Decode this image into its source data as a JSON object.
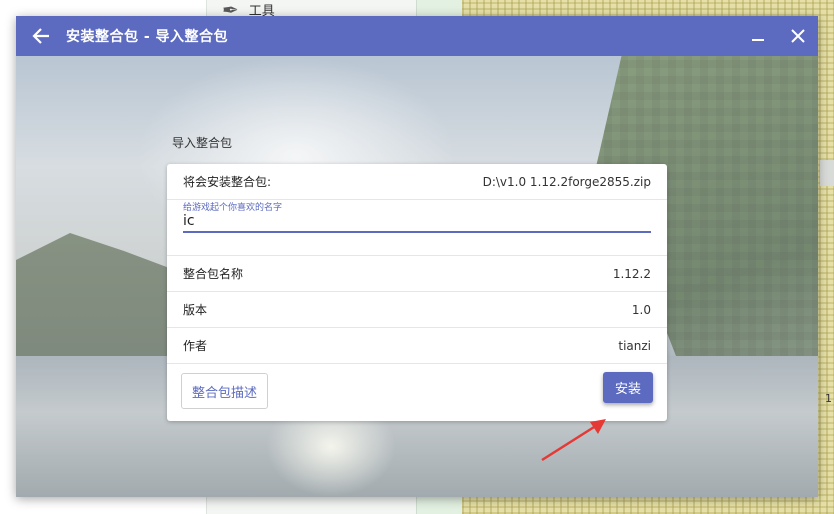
{
  "background": {
    "tool_label": "工具",
    "edge_number": "1"
  },
  "window": {
    "title": "安装整合包 - 导入整合包",
    "accent_color": "#5c6bc0",
    "icons": {
      "back": "arrow-left-icon",
      "minimize": "minimize-icon",
      "close": "close-icon"
    }
  },
  "import": {
    "section_title": "导入整合包",
    "file_label": "将会安装整合包:",
    "file_path": "D:\\v1.0 1.12.2forge2855.zip",
    "name_field": {
      "label": "给游戏起个你喜欢的名字",
      "value": "ic"
    },
    "rows": [
      {
        "label": "整合包名称",
        "value": "1.12.2"
      },
      {
        "label": "版本",
        "value": "1.0"
      },
      {
        "label": "作者",
        "value": "tianzi"
      }
    ],
    "description_button": "整合包描述",
    "install_button": "安装"
  },
  "annotation": {
    "arrow_color": "#e53935"
  }
}
